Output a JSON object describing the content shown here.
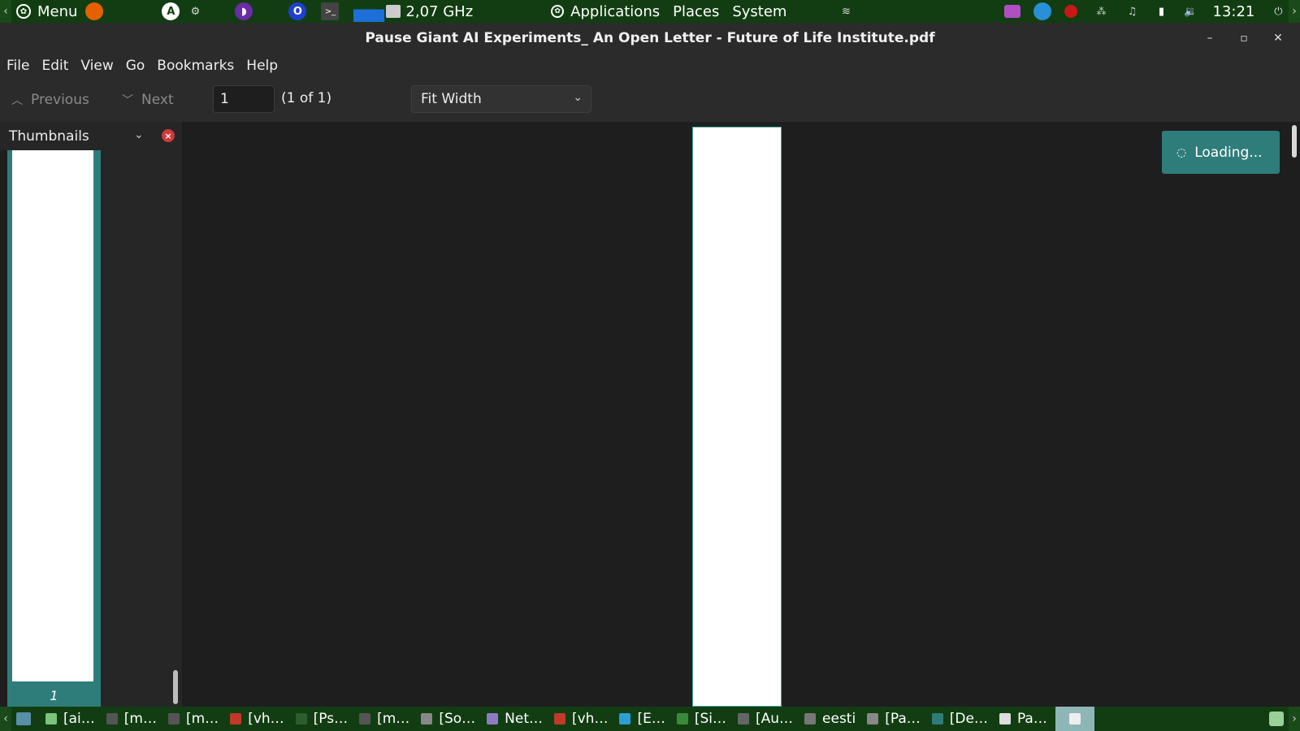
{
  "top_panel": {
    "menu_label": "Menu",
    "cpu_freq": "2,07 GHz",
    "applications": "Applications",
    "places": "Places",
    "system": "System",
    "clock": "13:21",
    "icons": [
      "mint-menu-icon",
      "firefox-icon",
      "accessibility-icon",
      "settings-gears-icon",
      "podcast-icon",
      "opera-icon",
      "terminal-icon",
      "cpu-graph-icon",
      "cpu-chip-icon",
      "wifi-icon",
      "media-icon",
      "chrome-icon",
      "recorder-icon",
      "network-icon",
      "notification-icon",
      "battery-icon",
      "volume-icon",
      "power-icon"
    ]
  },
  "window": {
    "title": "Pause Giant AI Experiments_ An Open Letter - Future of Life Institute.pdf"
  },
  "menubar": {
    "items": [
      "File",
      "Edit",
      "View",
      "Go",
      "Bookmarks",
      "Help"
    ]
  },
  "toolbar": {
    "previous_label": "Previous",
    "next_label": "Next",
    "page_value": "1",
    "page_count": "(1 of 1)",
    "zoom_value": "Fit Width"
  },
  "sidebar": {
    "title": "Thumbnails",
    "thumbnail_label": "1"
  },
  "document": {
    "loading_text": "Loading..."
  },
  "taskbar": {
    "tasks": [
      {
        "label": "[ai…",
        "color": "#7cc47c"
      },
      {
        "label": "[m…",
        "color": "#555555"
      },
      {
        "label": "[m…",
        "color": "#555555"
      },
      {
        "label": "[vh…",
        "color": "#c0392b"
      },
      {
        "label": "[Ps…",
        "color": "#2e5d2e"
      },
      {
        "label": "[m…",
        "color": "#555555"
      },
      {
        "label": "[So…",
        "color": "#888888"
      },
      {
        "label": "Net…",
        "color": "#8e7cc3"
      },
      {
        "label": "[vh…",
        "color": "#c0392b"
      },
      {
        "label": "[E…",
        "color": "#2a9fd6"
      },
      {
        "label": "[Si…",
        "color": "#3a8a3a"
      },
      {
        "label": "[Au…",
        "color": "#666666"
      },
      {
        "label": "eesti",
        "color": "#777777"
      },
      {
        "label": "[Pa…",
        "color": "#888888"
      },
      {
        "label": "[De…",
        "color": "#2f7d7a"
      },
      {
        "label": "Pa…",
        "color": "#dddddd"
      }
    ]
  },
  "colors": {
    "accent": "#2f7d7a",
    "panel": "#123d12",
    "background": "#1e1e1e"
  }
}
